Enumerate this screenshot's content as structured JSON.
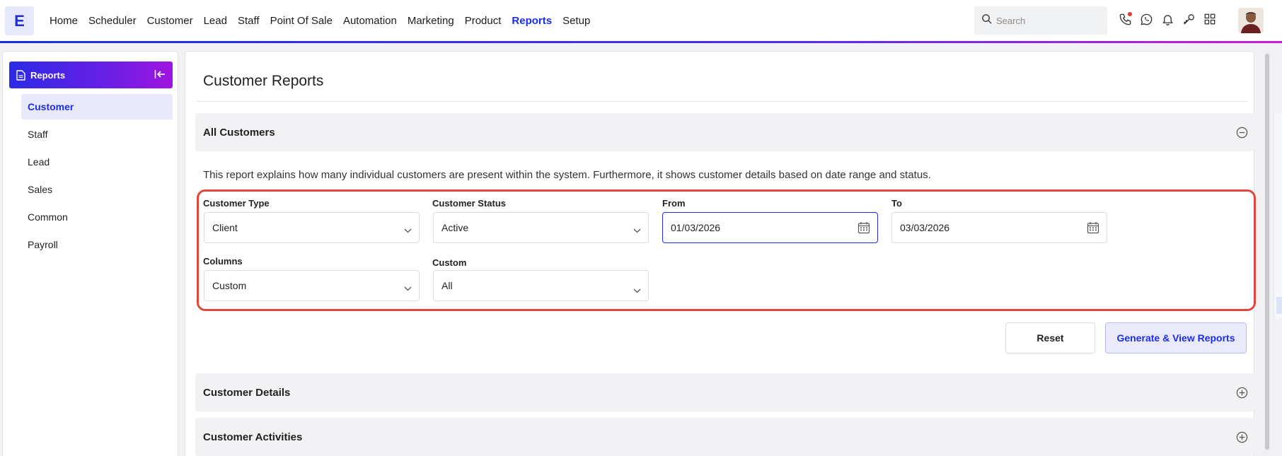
{
  "app": {
    "logo_letter": "E"
  },
  "nav": {
    "items": [
      "Home",
      "Scheduler",
      "Customer",
      "Lead",
      "Staff",
      "Point Of Sale",
      "Automation",
      "Marketing",
      "Product",
      "Reports",
      "Setup"
    ],
    "active": "Reports"
  },
  "search": {
    "placeholder": "Search",
    "value": ""
  },
  "topbar_icons": [
    "phone-icon",
    "whatsapp-icon",
    "bell-icon",
    "key-icon",
    "apps-grid-icon"
  ],
  "sidebar": {
    "title": "Reports",
    "items": [
      {
        "label": "Customer",
        "active": true
      },
      {
        "label": "Staff",
        "active": false
      },
      {
        "label": "Lead",
        "active": false
      },
      {
        "label": "Sales",
        "active": false
      },
      {
        "label": "Common",
        "active": false
      },
      {
        "label": "Payroll",
        "active": false
      }
    ]
  },
  "main": {
    "title": "Customer Reports",
    "sections": {
      "all_customers": "All Customers",
      "customer_details": "Customer Details",
      "customer_activities": "Customer Activities"
    },
    "description": "This report explains how many individual customers are present within the system. Furthermore, it shows customer details based on date range and status.",
    "filters": {
      "customer_type": {
        "label": "Customer Type",
        "value": "Client"
      },
      "customer_status": {
        "label": "Customer Status",
        "value": "Active"
      },
      "from": {
        "label": "From",
        "value": "01/03/2026"
      },
      "to": {
        "label": "To",
        "value": "03/03/2026"
      },
      "columns": {
        "label": "Columns",
        "value": "Custom"
      },
      "custom": {
        "label": "Custom",
        "value": "All"
      }
    },
    "buttons": {
      "reset": "Reset",
      "generate": "Generate & View Reports"
    }
  },
  "colors": {
    "accent": "#1a2ee8",
    "highlight_border": "#e0473a",
    "sidebar_gradient_start": "#2a2be6",
    "sidebar_gradient_end": "#a014e0"
  }
}
